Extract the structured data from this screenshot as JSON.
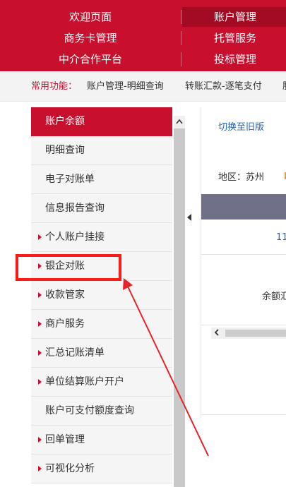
{
  "topnav": {
    "rows": [
      {
        "left": "欢迎页面",
        "right": "账户管理"
      },
      {
        "left": "商务卡管理",
        "right": "托管服务"
      },
      {
        "left": "中介合作平台",
        "right": "投标管理"
      }
    ],
    "active_color": "#a30b23",
    "bg_color": "#c8102e"
  },
  "common": {
    "label": "常用功能：",
    "links": [
      "账户管理-明细查询",
      "转账汇款-逐笔支付",
      "服"
    ]
  },
  "sidebar": {
    "items": [
      {
        "label": "账户余额",
        "arrow": false,
        "active": true
      },
      {
        "label": "明细查询",
        "arrow": false,
        "active": false
      },
      {
        "label": "电子对账单",
        "arrow": false,
        "active": false
      },
      {
        "label": "信息报告查询",
        "arrow": false,
        "active": false
      },
      {
        "label": "个人账户挂接",
        "arrow": true,
        "active": false
      },
      {
        "label": "银企对账",
        "arrow": true,
        "active": false
      },
      {
        "label": "收款管家",
        "arrow": true,
        "active": false
      },
      {
        "label": "商户服务",
        "arrow": true,
        "active": false
      },
      {
        "label": "汇总记账清单",
        "arrow": true,
        "active": false
      },
      {
        "label": "单位结算账户开户",
        "arrow": true,
        "active": false
      },
      {
        "label": "账户可支付额度查询",
        "arrow": false,
        "active": false
      },
      {
        "label": "回单管理",
        "arrow": true,
        "active": false
      },
      {
        "label": "可视化分析",
        "arrow": true,
        "active": false
      }
    ]
  },
  "content": {
    "switch_link": "切换至旧版",
    "region": "地区：苏州",
    "row_number": "11",
    "balance_label": "余额汇"
  },
  "annotation": {
    "color": "#ff1a1a"
  }
}
